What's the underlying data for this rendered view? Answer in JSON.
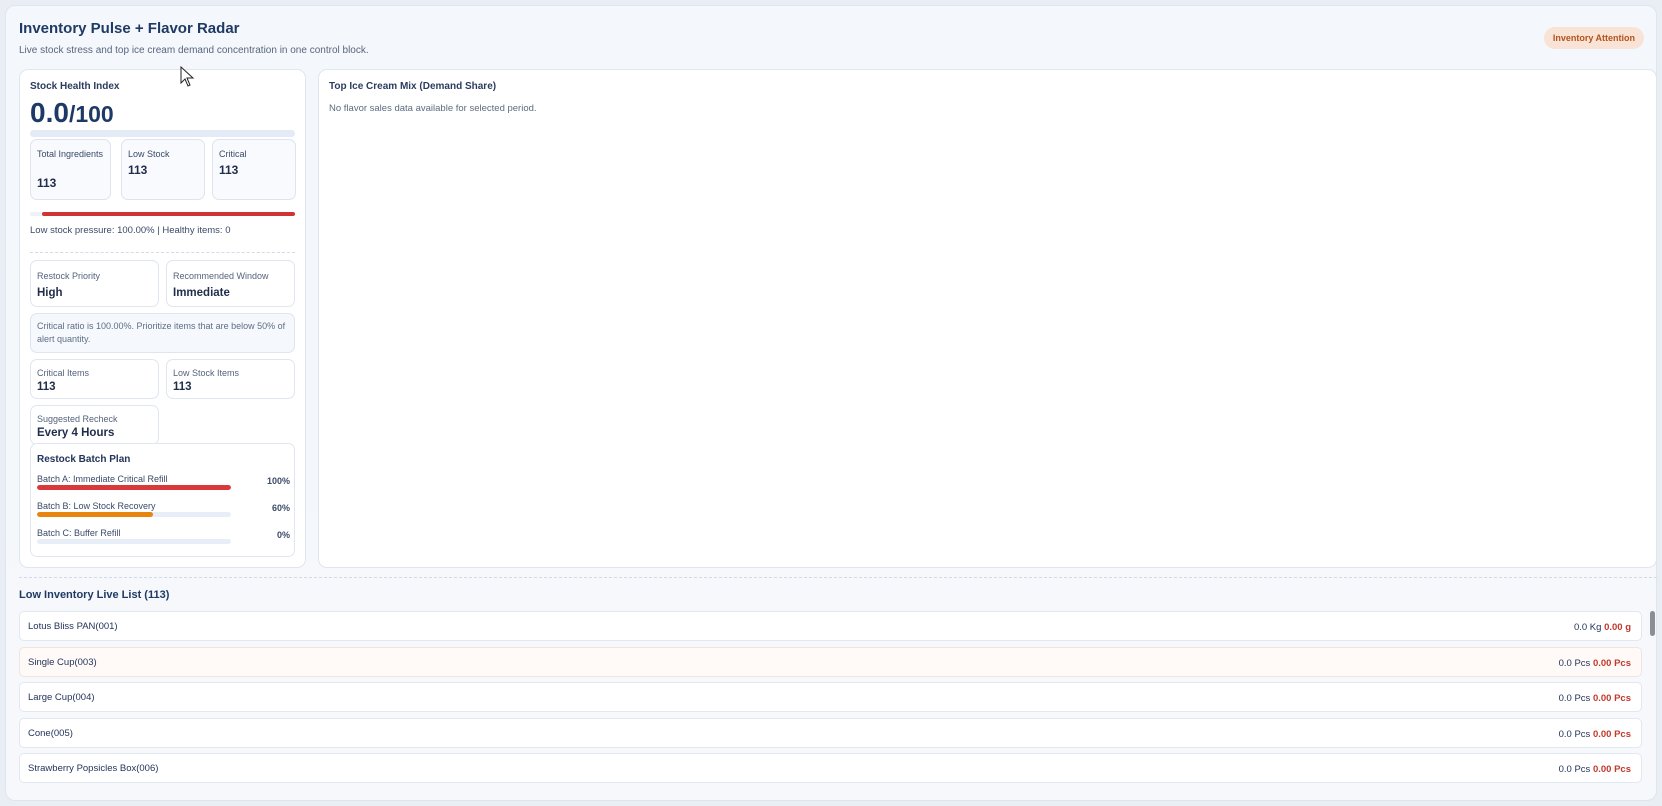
{
  "header": {
    "title": "Inventory Pulse + Flavor Radar",
    "subtitle": "Live stock stress and top ice cream demand concentration in one control block.",
    "badge": "Inventory Attention"
  },
  "health": {
    "label": "Stock Health Index",
    "score": "0.0",
    "max": "/100",
    "score_fraction": 0.0,
    "stats": [
      {
        "label": "Total Ingredients",
        "value": "113"
      },
      {
        "label": "Low Stock",
        "value": "113"
      },
      {
        "label": "Critical",
        "value": "113"
      }
    ],
    "pressure_fraction": 1.0,
    "pressure_text": "Low stock pressure: 100.00% | Healthy items: 0",
    "restock_priority": {
      "label": "Restock Priority",
      "value": "High"
    },
    "recommended_window": {
      "label": "Recommended Window",
      "value": "Immediate"
    },
    "note": "Critical ratio is 100.00%. Prioritize items that are below 50% of alert quantity.",
    "critical_items": {
      "label": "Critical Items",
      "value": "113"
    },
    "low_stock_items": {
      "label": "Low Stock Items",
      "value": "113"
    },
    "suggested_recheck": {
      "label": "Suggested Recheck",
      "value": "Every 4 Hours"
    },
    "batch_plan": {
      "title": "Restock Batch Plan",
      "batches": [
        {
          "name": "Batch A: Immediate Critical Refill",
          "percent": "100%",
          "fraction": 1.0,
          "color": "#d9393a"
        },
        {
          "name": "Batch B: Low Stock Recovery",
          "percent": "60%",
          "fraction": 0.6,
          "color": "#e8850f"
        },
        {
          "name": "Batch C: Buffer Refill",
          "percent": "0%",
          "fraction": 0.0,
          "color": "#4f8fe0"
        }
      ]
    }
  },
  "mix": {
    "title": "Top Ice Cream Mix (Demand Share)",
    "empty": "No flavor sales data available for selected period."
  },
  "list": {
    "title": "Low Inventory Live List (113)",
    "items": [
      {
        "name": "Lotus Bliss PAN(001)",
        "qty": "0.0 Kg",
        "alert": "0.00 g"
      },
      {
        "name": "Single Cup(003)",
        "qty": "0.0 Pcs",
        "alert": "0.00 Pcs"
      },
      {
        "name": "Large Cup(004)",
        "qty": "0.0 Pcs",
        "alert": "0.00 Pcs"
      },
      {
        "name": "Cone(005)",
        "qty": "0.0 Pcs",
        "alert": "0.00 Pcs"
      },
      {
        "name": "Strawberry Popsicles Box(006)",
        "qty": "0.0 Pcs",
        "alert": "0.00 Pcs"
      }
    ]
  }
}
